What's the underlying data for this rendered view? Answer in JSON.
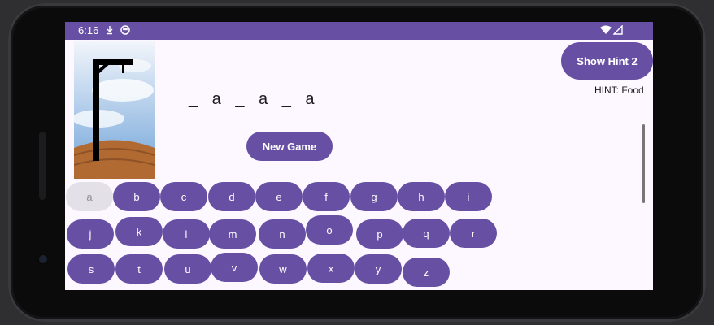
{
  "status_bar": {
    "time": "6:16",
    "icons": [
      "download-icon",
      "record-icon"
    ],
    "right_icons": [
      "wifi-icon",
      "signal-icon"
    ],
    "accent": "#6750a4"
  },
  "game": {
    "word_display": "_ a _ a _ a",
    "new_game_label": "New Game",
    "hint_button_label": "Show Hint 2",
    "hint_text": "HINT: Food"
  },
  "keyboard": {
    "row1": [
      "a",
      "b",
      "c",
      "d",
      "e",
      "f",
      "g",
      "h",
      "i"
    ],
    "row2": [
      "j",
      "k",
      "l",
      "m",
      "n",
      "o",
      "p",
      "q",
      "r"
    ],
    "row3": [
      "s",
      "t",
      "u",
      "v",
      "w",
      "x",
      "y",
      "z"
    ],
    "used": [
      "a"
    ]
  },
  "colors": {
    "primary": "#6750a4",
    "background": "#fdf7ff",
    "used_key": "#e4e0e8"
  }
}
